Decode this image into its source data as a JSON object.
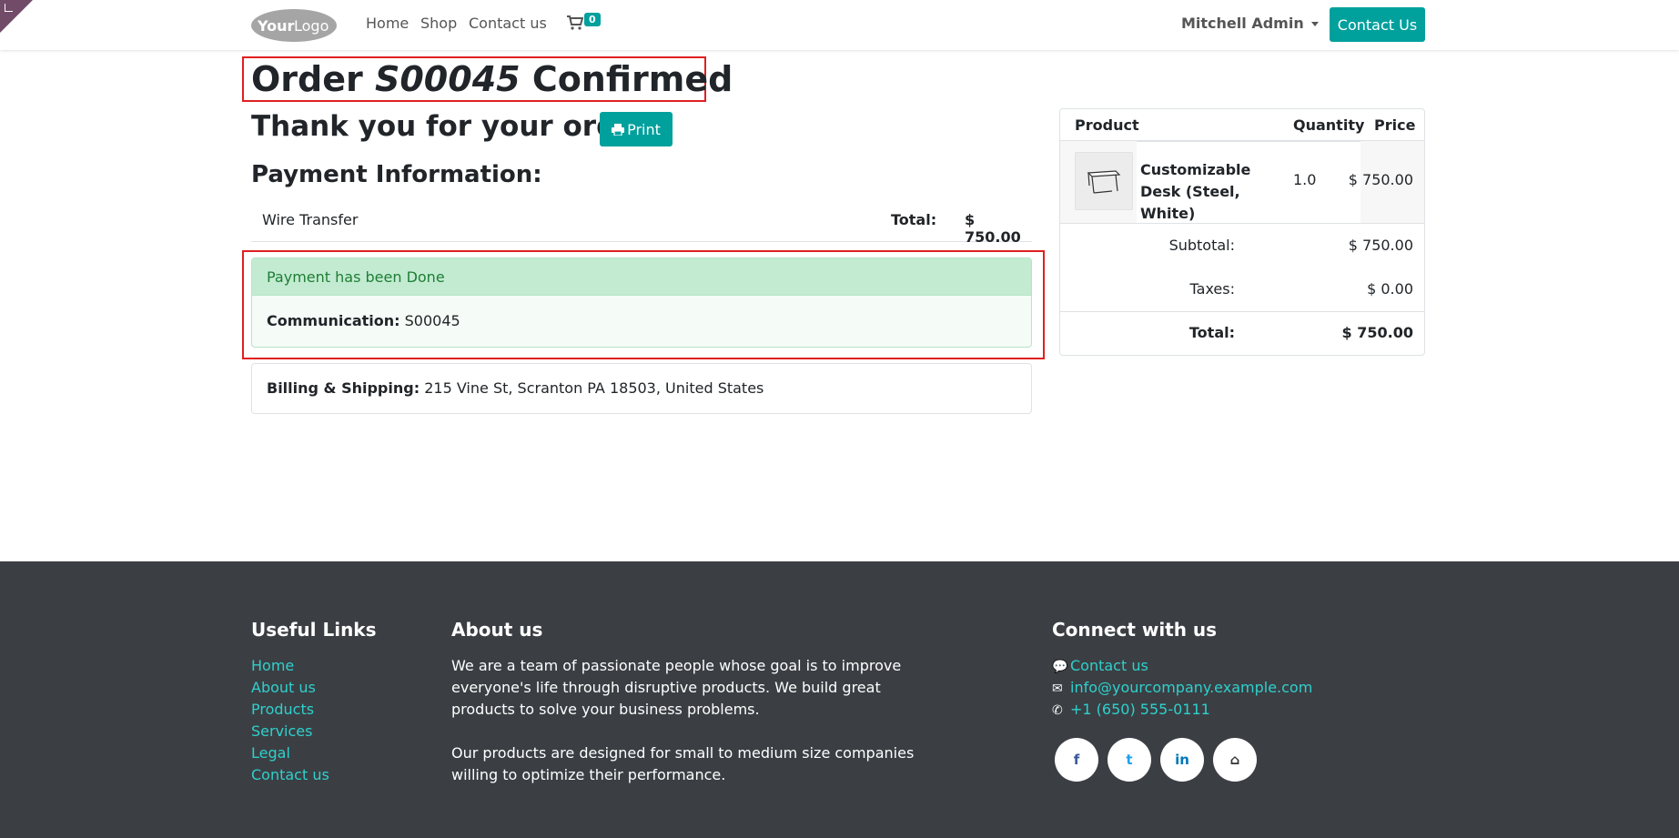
{
  "header": {
    "logo_alt": "YourLogo",
    "logo_text": "Your",
    "logo_text2": "Logo",
    "nav": [
      "Home",
      "Shop",
      "Contact us"
    ],
    "cart_count": "0",
    "user": "Mitchell Admin",
    "contact_button": "Contact Us"
  },
  "order": {
    "title_prefix": "Order",
    "number": "S00045",
    "title_suffix": "Confirmed",
    "thanks": "Thank you for your order.",
    "print_label": "Print"
  },
  "payment": {
    "heading": "Payment Information:",
    "method": "Wire Transfer",
    "total_label": "Total:",
    "total_value": "$ 750.00",
    "status": "Payment has been Done",
    "communication_label": "Communication:",
    "communication_value": "S00045"
  },
  "billing": {
    "label": "Billing & Shipping:",
    "address": "215 Vine St, Scranton PA 18503, United States"
  },
  "summary": {
    "headers": [
      "Product",
      "Quantity",
      "Price"
    ],
    "items": [
      {
        "name": "Customizable Desk (Steel, White)",
        "quantity": "1.0",
        "price": "$ 750.00"
      }
    ],
    "subtotal_label": "Subtotal:",
    "subtotal_value": "$ 750.00",
    "taxes_label": "Taxes:",
    "taxes_value": "$ 0.00",
    "total_label": "Total:",
    "total_value": "$ 750.00"
  },
  "footer": {
    "useful_links_title": "Useful Links",
    "useful_links": [
      "Home",
      "About us",
      "Products",
      "Services",
      "Legal",
      "Contact us"
    ],
    "about_title": "About us",
    "about_p1": "We are a team of passionate people whose goal is to improve everyone's life through disruptive products. We build great products to solve your business problems.",
    "about_p2": "Our products are designed for small to medium size companies willing to optimize their performance.",
    "connect_title": "Connect with us",
    "connect": [
      {
        "icon": "comment-icon",
        "text": "Contact us"
      },
      {
        "icon": "envelope-icon",
        "text": "info@yourcompany.example.com"
      },
      {
        "icon": "phone-icon",
        "text": "+1 (650) 555-0111"
      }
    ],
    "social": [
      {
        "icon": "facebook-icon",
        "glyph": "f"
      },
      {
        "icon": "twitter-icon",
        "glyph": "t"
      },
      {
        "icon": "linkedin-icon",
        "glyph": "in"
      },
      {
        "icon": "home-icon",
        "glyph": "⌂"
      }
    ]
  },
  "colors": {
    "primary": "#00a09d",
    "footer_bg": "#3b3f44",
    "footer_link": "#2fd0cc",
    "alert_bg": "#c3ebd2",
    "alert_text": "#1e7e34",
    "highlight": "#e02020",
    "corner": "#714b67"
  }
}
